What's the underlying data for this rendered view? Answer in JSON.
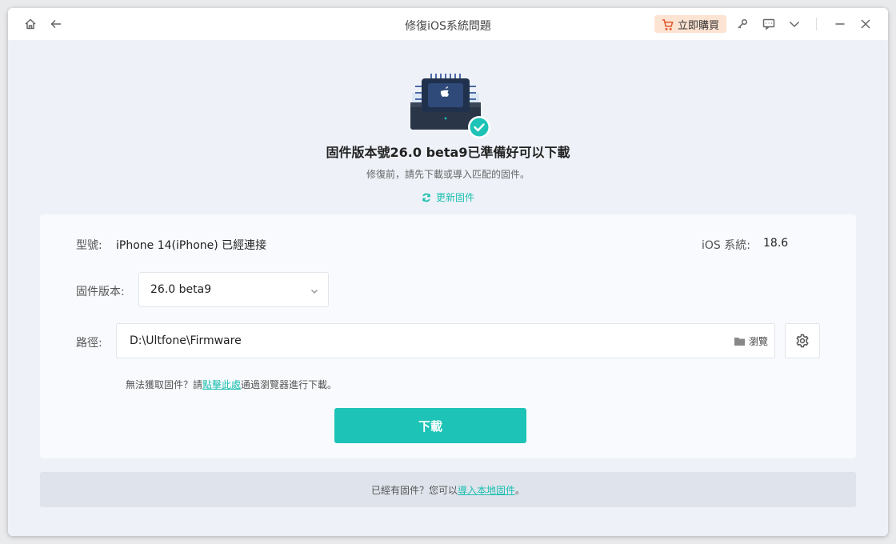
{
  "window": {
    "title": "修復iOS系統問題"
  },
  "titlebar": {
    "buy_label": "立即購買",
    "icons": [
      "home-icon",
      "back-arrow-icon",
      "cart-icon",
      "key-icon",
      "feedback-icon",
      "chevron-down-icon",
      "minimize-icon",
      "close-icon"
    ]
  },
  "hero": {
    "title": "固件版本號26.0 beta9已準備好可以下載",
    "subtitle": "修復前，請先下載或導入匹配的固件。",
    "refresh_label": "更新固件"
  },
  "device": {
    "model_label": "型號:",
    "model_value": "iPhone 14(iPhone) 已經連接",
    "ios_label": "iOS 系統:",
    "ios_value": "18.6"
  },
  "firmware": {
    "label": "固件版本:",
    "selected": "26.0 beta9"
  },
  "path": {
    "label": "路徑:",
    "value": "D:\\Ultfone\\Firmware",
    "browse_label": "瀏覽"
  },
  "hint": {
    "prefix": "無法獲取固件？請",
    "link": "點擊此處",
    "suffix": "通過瀏覽器進行下載。"
  },
  "download_label": "下載",
  "footer": {
    "prefix": "已經有固件？您可以",
    "link": "導入本地固件",
    "suffix": "。"
  },
  "colors": {
    "accent": "#1dc3b6",
    "buy_bg": "#fde3d2",
    "buy_icon": "#e2562b"
  }
}
